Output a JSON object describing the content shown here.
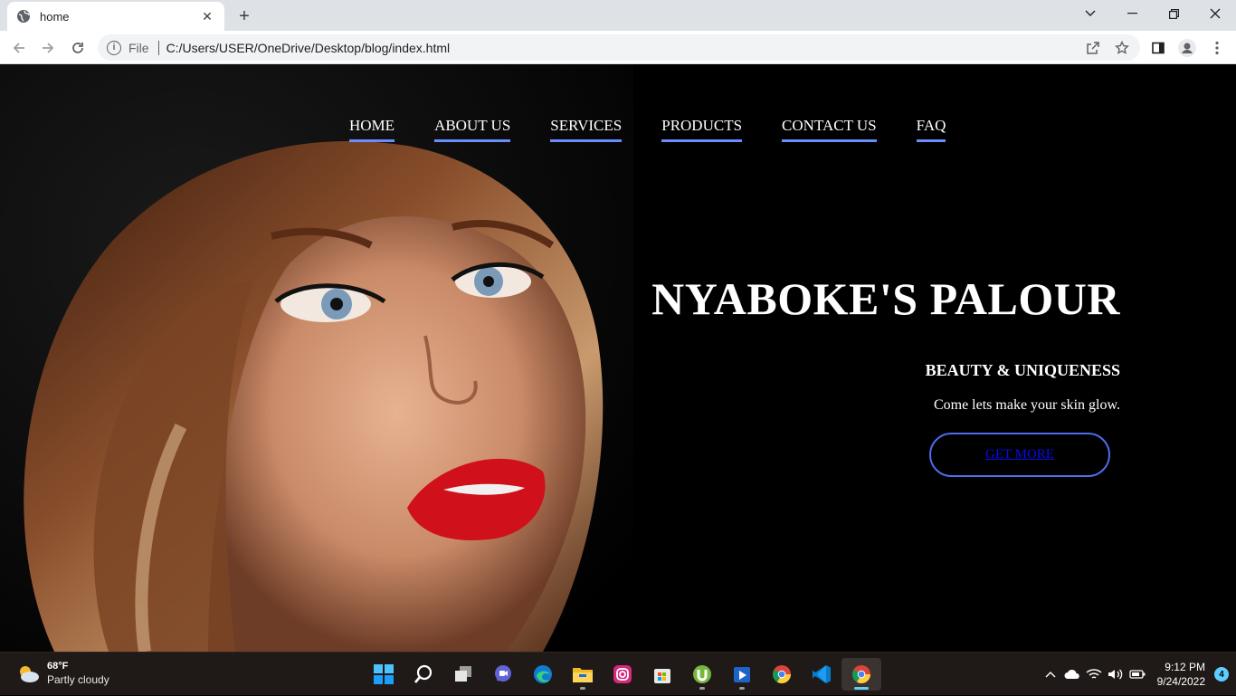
{
  "browser": {
    "tab_title": "home",
    "new_tab_symbol": "+",
    "tab_close_symbol": "✕",
    "url_scheme_label": "File",
    "url_path": "C:/Users/USER/OneDrive/Desktop/blog/index.html"
  },
  "site": {
    "nav": [
      "HOME",
      "ABOUT US",
      "SERVICES",
      "PRODUCTS",
      "CONTACT US",
      "FAQ"
    ],
    "hero_title": "NYABOKE'S PALOUR",
    "hero_subtitle": "BEAUTY & UNIQUENESS",
    "hero_text": "Come lets make your skin glow.",
    "cta_label": "GET MORE",
    "accent_color": "#6b8cff"
  },
  "taskbar": {
    "weather_temp": "68°F",
    "weather_condition": "Partly cloudy",
    "clock_time": "9:12 PM",
    "clock_date": "9/24/2022",
    "notification_count": "4",
    "apps": [
      "start-icon",
      "search-icon",
      "task-view-icon",
      "chat-icon",
      "edge-icon",
      "file-explorer-icon",
      "instagram-icon",
      "store-icon",
      "utorrent-icon",
      "media-player-icon",
      "chrome-icon",
      "vscode-icon",
      "chrome-active-icon"
    ]
  }
}
